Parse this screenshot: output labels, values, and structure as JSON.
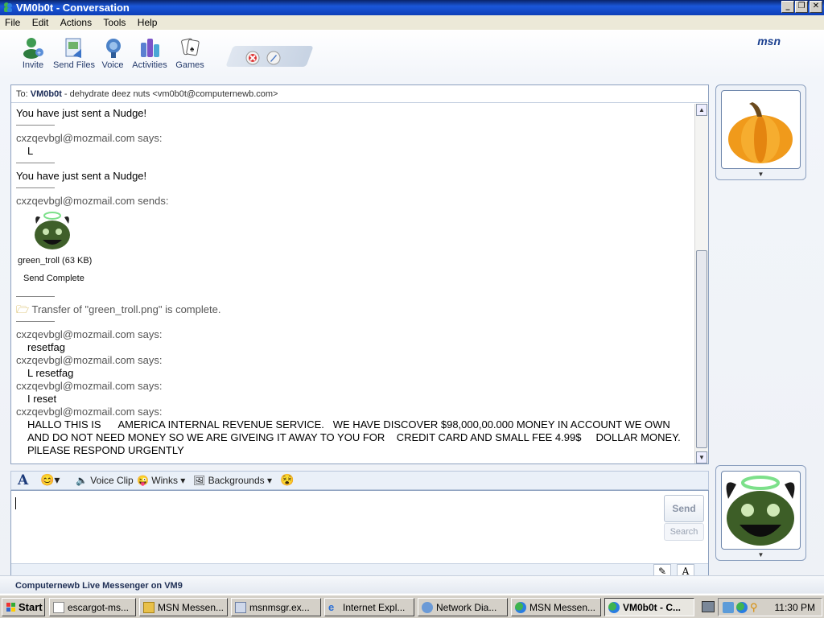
{
  "window": {
    "title": "VM0b0t - Conversation",
    "buttons": [
      "_",
      "❐",
      "✕"
    ]
  },
  "menu": [
    "File",
    "Edit",
    "Actions",
    "Tools",
    "Help"
  ],
  "toolbar": {
    "items": [
      "Invite",
      "Send Files",
      "Voice",
      "Activities",
      "Games"
    ],
    "brand": "msn"
  },
  "conversation": {
    "to_label": "To:",
    "to_name": "VM0b0t",
    "to_detail": " - dehydrate deez nuts <vm0b0t@computernewb.com>",
    "nudge_1": "You have just sent a Nudge!",
    "says_1": "cxzqevbgl@mozmail.com says:",
    "msg_1": "L",
    "nudge_2": "You have just sent a Nudge!",
    "sends": "cxzqevbgl@mozmail.com sends:",
    "file_name": "green_troll (63 KB)",
    "send_complete": "Send Complete",
    "transfer": "Transfer of \"green_troll.png\" is complete.",
    "says_2": "cxzqevbgl@mozmail.com says:",
    "msg_2": "resetfag",
    "says_3": "cxzqevbgl@mozmail.com says:",
    "msg_3": "L resetfag",
    "says_4": "cxzqevbgl@mozmail.com says:",
    "msg_4": "I reset",
    "says_5": "cxzqevbgl@mozmail.com says:",
    "msg_5": "HALLO THIS IS      AMERICA INTERNAL REVENUE SERVICE.   WE HAVE DISCOVER $98,000,00.000 MONEY IN ACCOUNT WE OWN AND DO NOT NEED MONEY SO WE ARE GIVEING IT AWAY TO YOU FOR    CREDIT CARD AND SMALL FEE 4.99$     DOLLAR MONEY. PlLEASE RESPOND URGENTLY"
  },
  "format_bar": {
    "voice_clip": "Voice Clip",
    "winks": "Winks",
    "backgrounds": "Backgrounds"
  },
  "input": {
    "send": "Send",
    "search": "Search"
  },
  "status": "Computernewb Live Messenger on VM9",
  "taskbar": {
    "start": "Start",
    "tasks": [
      "escargot-ms...",
      "MSN Messen...",
      "msnmsgr.ex...",
      "Internet Expl...",
      "Network Dia...",
      "MSN Messen...",
      "VM0b0t - C..."
    ],
    "clock": "11:30 PM"
  }
}
